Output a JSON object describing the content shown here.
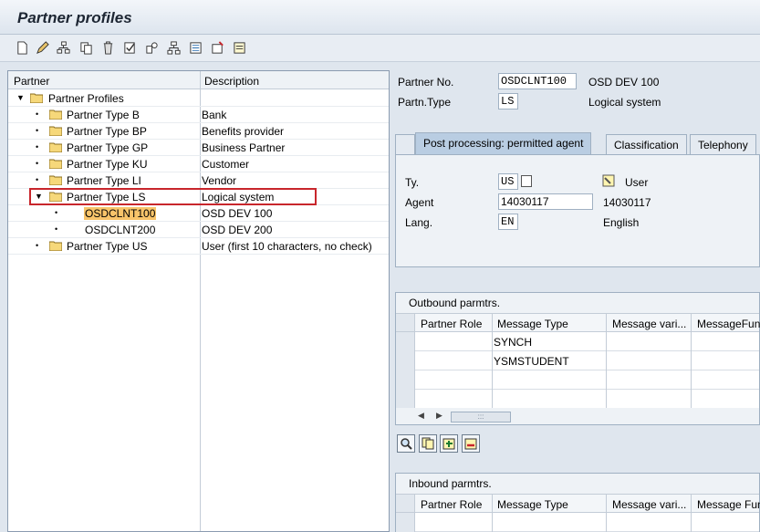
{
  "window": {
    "title": "Partner profiles"
  },
  "toolbar": {
    "icons": [
      "new-icon",
      "edit-icon",
      "hierarchy-icon",
      "copy-icon",
      "delete-icon",
      "check-icon",
      "display-icon",
      "tree-icon",
      "print-icon",
      "settings-icon"
    ]
  },
  "tree": {
    "col_partner": "Partner",
    "col_description": "Description",
    "root": "Partner Profiles",
    "rows": [
      {
        "label": "Partner Type B",
        "desc": "Bank"
      },
      {
        "label": "Partner Type BP",
        "desc": "Benefits provider"
      },
      {
        "label": "Partner Type GP",
        "desc": "Business Partner"
      },
      {
        "label": "Partner Type KU",
        "desc": "Customer"
      },
      {
        "label": "Partner Type LI",
        "desc": "Vendor"
      },
      {
        "label": "Partner Type LS",
        "desc": "Logical system"
      },
      {
        "label": "OSDCLNT100",
        "desc": "OSD DEV 100"
      },
      {
        "label": "OSDCLNT200",
        "desc": "OSD DEV 200"
      },
      {
        "label": "Partner Type US",
        "desc": "User (first 10 characters, no check)"
      }
    ]
  },
  "header": {
    "partner_no_label": "Partner No.",
    "partner_no_value": "OSDCLNT100",
    "partner_no_desc": "OSD DEV 100",
    "partn_type_label": "Partn.Type",
    "partn_type_value": "LS",
    "partn_type_desc": "Logical system"
  },
  "tabs": [
    "Post processing: permitted agent",
    "Classification",
    "Telephony"
  ],
  "agent_panel": {
    "ty_label": "Ty.",
    "ty_value": "US",
    "ty_desc": "User",
    "agent_label": "Agent",
    "agent_value": "14030117",
    "agent_desc": "14030117",
    "lang_label": "Lang.",
    "lang_value": "EN",
    "lang_desc": "English"
  },
  "outbound": {
    "title": "Outbound parmtrs.",
    "columns": [
      "Partner Role",
      "Message Type",
      "Message vari...",
      "MessageFun..."
    ],
    "rows": [
      {
        "message_type": "SYNCH"
      },
      {
        "message_type": "YSMSTUDENT"
      }
    ]
  },
  "inbound": {
    "title": "Inbound parmtrs.",
    "columns": [
      "Partner Role",
      "Message Type",
      "Message vari...",
      "Message Fun..."
    ]
  }
}
